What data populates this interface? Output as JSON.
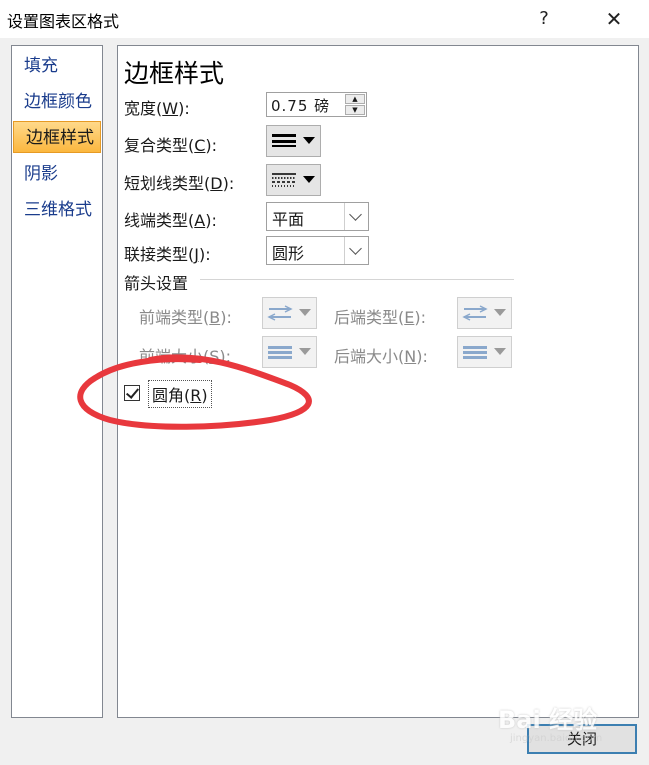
{
  "window": {
    "title": "设置图表区格式",
    "help": "?",
    "close": "✕"
  },
  "sidebar": {
    "items": [
      {
        "label": "填充",
        "active": false
      },
      {
        "label": "边框颜色",
        "active": false
      },
      {
        "label": "边框样式",
        "active": true
      },
      {
        "label": "阴影",
        "active": false
      },
      {
        "label": "三维格式",
        "active": false
      }
    ]
  },
  "panel": {
    "title": "边框样式",
    "width": {
      "label_pre": "宽度(",
      "key": "W",
      "label_post": "):",
      "value": "0.75 磅"
    },
    "compound": {
      "label_pre": "复合类型(",
      "key": "C",
      "label_post": "):"
    },
    "dash": {
      "label_pre": "短划线类型(",
      "key": "D",
      "label_post": "):"
    },
    "cap": {
      "label_pre": "线端类型(",
      "key": "A",
      "label_post": "):",
      "value": "平面"
    },
    "join": {
      "label_pre": "联接类型(",
      "key": "J",
      "label_post": "):",
      "value": "圆形"
    },
    "arrow_section": "箭头设置",
    "begin_type": {
      "label_pre": "前端类型(",
      "key": "B",
      "label_post": "):"
    },
    "end_type": {
      "label_pre": "后端类型(",
      "key": "E",
      "label_post": "):"
    },
    "begin_size": {
      "label_pre": "前端大小(",
      "key": "S",
      "label_post": "):"
    },
    "end_size": {
      "label_pre": "后端大小(",
      "key": "N",
      "label_post": "):"
    },
    "rounded": {
      "label_pre": "圆角(",
      "key": "R",
      "label_post": ")",
      "checked": true
    }
  },
  "footer": {
    "close_label": "关闭"
  },
  "watermark": {
    "text": "Bai 经验",
    "sub": "jingyan.baidu.com"
  },
  "colors": {
    "accent": "#fbb73f",
    "annotation": "#e8383d",
    "link": "#1a3c8c"
  },
  "icons": [
    "help-icon",
    "close-icon",
    "spin-up-icon",
    "spin-down-icon",
    "compound-line-icon",
    "dash-line-icon",
    "arrow-type-icon",
    "arrow-size-icon",
    "chevron-down-icon",
    "checkmark-icon"
  ]
}
